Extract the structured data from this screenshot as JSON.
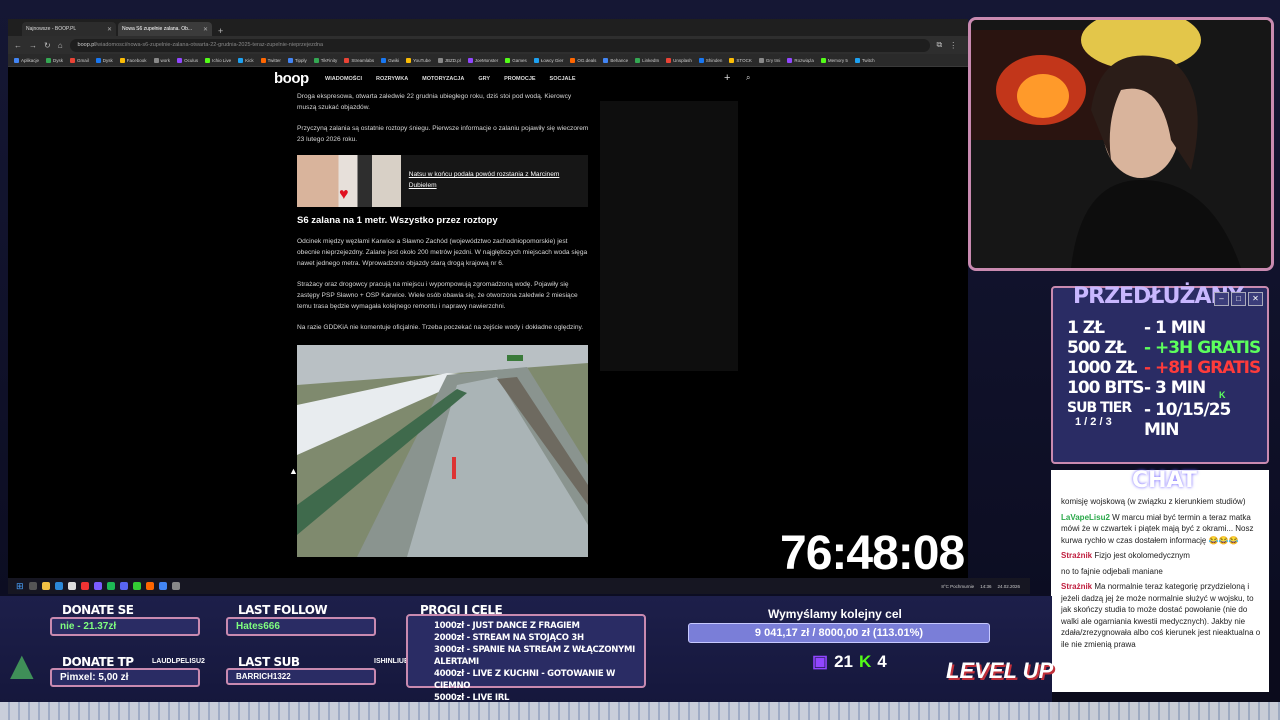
{
  "browser": {
    "tabs": [
      {
        "label": "Najnowsze - BOOP.PL"
      },
      {
        "label": "Nowa S6 zupełnie zalana. Ob..."
      }
    ],
    "url": "boop.pl",
    "url_path": "/wiadomosci/nowa-s6-zupelnie-zalana-otwarta-22-grudnia-2025-teraz-zupelnie-nieprzejezdna",
    "bookmarks": [
      "Aplikacje",
      "Dysk",
      "Gmail",
      "Dysk",
      "Facebook",
      "work",
      "Oculus",
      "Ichio Live",
      "Kick",
      "Twitter",
      "Tipply",
      "TikFinity",
      "Streamlabs",
      "Gwiki",
      "YouTube",
      "JBZD.pl",
      "JoeMonster",
      "Games",
      "Łowcy Gier",
      "OG.deals",
      "Behance",
      "LinkedIn",
      "Unsplash",
      "Shinden",
      "STOCK",
      "Gry tmi",
      "Rozwiąża",
      "Memory 5",
      "Twitch"
    ]
  },
  "site": {
    "logo": "boop",
    "nav": [
      "WIADOMOŚCI",
      "ROZRYWKA",
      "MOTORYZACJA",
      "GRY",
      "PROMOCJE",
      "SOCJALE"
    ]
  },
  "article": {
    "p1": "Droga ekspresowa, otwarta zaledwie 22 grudnia ubiegłego roku, dziś stoi pod wodą. Kierowcy muszą szukać objazdów.",
    "p2": "Przyczyną zalania są ostatnie roztopy śniegu. Pierwsze informacje o zalaniu pojawiły się wieczorem 23 lutego 2026 roku.",
    "related": "Natsu w końcu podała powód rozstania z Marcinem Dubielem",
    "heading": "S6 zalana na 1 metr. Wszystko przez roztopy",
    "p3": "Odcinek między węzłami Karwice a Sławno Zachód (województwo zachodniopomorskie) jest obecnie nieprzejezdny. Zalane jest około 200 metrów jezdni. W najgłębszych miejscach woda sięga nawet jednego metra. Wprowadzono objazdy starą drogą krajową nr 6.",
    "p4": "Strażacy oraz drogowcy pracują na miejscu i wypompowują zgromadzoną wodę. Pojawiły się zastępy PSP Sławno + OSP Karwice. Wiele osób obawia się, że otworzona zaledwie 2 miesiące temu trasa będzie wymagała kolejnego remontu i naprawy nawierzchni.",
    "p5": "Na razie GDDKiA nie komentuje oficjalnie. Trzeba poczekać na zejście wody i dokładne oględziny."
  },
  "taskbar": {
    "weather": "8°C Pochmurnie",
    "time": "14:36",
    "date": "24.02.2026"
  },
  "timer": "76:48:08",
  "prices": {
    "title": "PRZEDŁUŻANY",
    "rows": [
      {
        "left": "1 ZŁ",
        "right": "- 1 MIN"
      },
      {
        "left": "500 ZŁ",
        "right": "- +3H GRATIS"
      },
      {
        "left": "1000 ZŁ",
        "right": "- +8H GRATIS"
      },
      {
        "left": "100 BITS",
        "right": "- 3 MIN"
      },
      {
        "left": "SUB TIER",
        "right": "- 10/15/25 MIN"
      }
    ],
    "tiers": "1 / 2 / 3",
    "k": "K"
  },
  "chat": {
    "title": "CHAT",
    "messages": [
      {
        "user": "",
        "text": "komisję wojskową (w związku z kierunkiem studiów)"
      },
      {
        "user": "LaVapeLisu2",
        "text": "W marcu miał być termin a teraz matka mówi że w czwartek i piątek mają być z okrami... Nosz kurwa rychło w czas dostałem informację 😂😂😂"
      },
      {
        "user": "Strażnik",
        "text": "Fizjo jest okolomedycznym"
      },
      {
        "user": "",
        "text": "no to fajnie odjebali maniane"
      },
      {
        "user": "Strażnik",
        "text": "Ma normalnie teraz kategorię przydzieloną i jeżeli dadzą jej że może normalnie służyć w wojsku, to jak skończy studia to może dostać powołanie (nie do walki ale ogarniania kwestii medycznych). Jakby nie zdała/zrezygnowała albo coś kierunek jest nieaktualna o ile nie zmienią prawa"
      }
    ]
  },
  "overlay": {
    "donate_se_label": "DONATE SE",
    "donate_se_value": "nie - 21.37zł",
    "donate_tp_label": "DONATE TP",
    "donate_tp_value": "Pimxel: 5,00 zł",
    "last_follow_label": "LAST FOLLOW",
    "last_follow_value": "Hates666",
    "last_sub_label": "LAST SUB",
    "last_sub_value": "BARRICH1322",
    "goals_title": "PROGI I CELE",
    "goals": [
      "1000zł - JUST DANCE Z FRAGIEM",
      "2000zł - STREAM NA STOJĄCO 3H",
      "3000zł - SPANIE NA STREAM Z WŁĄCZONYMI ALERTAMI",
      "4000zł - LIVE Z KUCHNI - GOTOWANIE W CIEMNO",
      "5000zł - LIVE IRL"
    ],
    "goal_title": "Wymyślamy kolejny cel",
    "goal_progress": "9 041,17 zł / 8000,00 zł (113.01%)",
    "goal_fraction": 1.1301,
    "subs": "21",
    "kicks": "4",
    "levelup": "LEVEL UP",
    "pet1": "LAUDLPELISU2",
    "pet2": "ISHINLIUE",
    "pet3": "STRAŻNLK"
  }
}
